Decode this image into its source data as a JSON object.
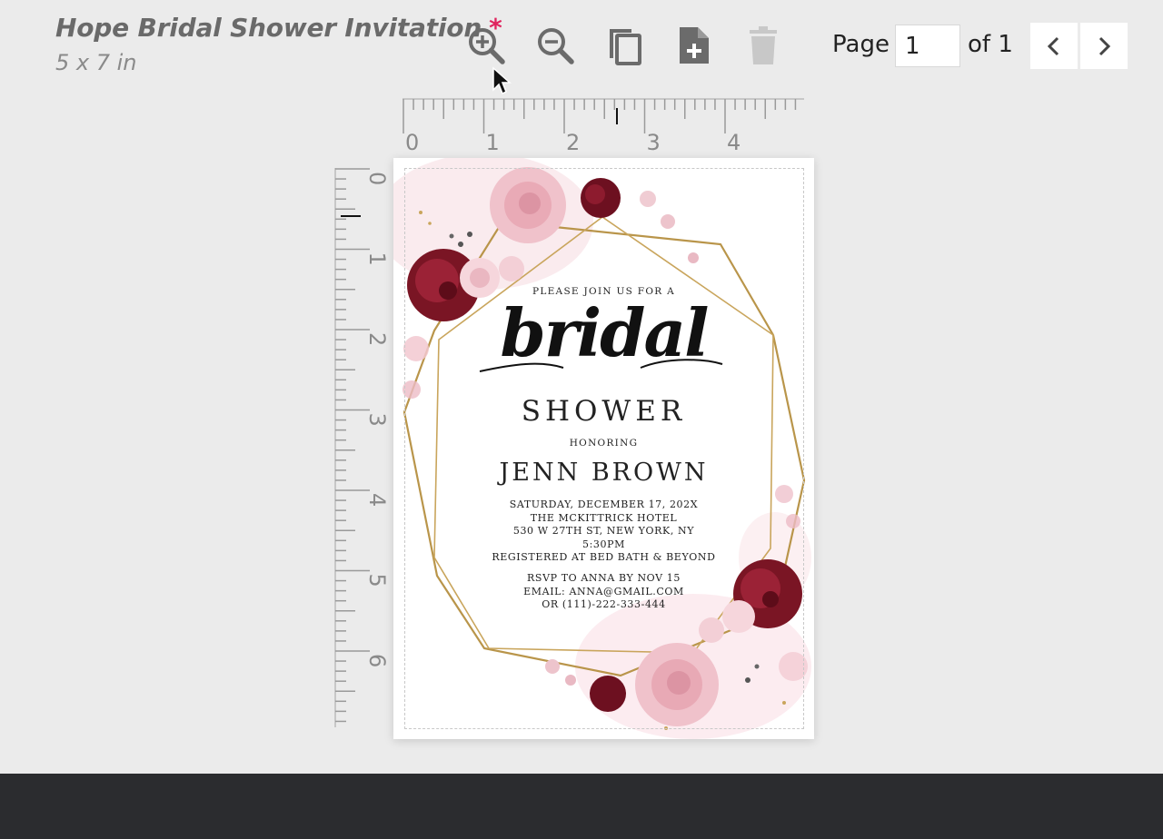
{
  "header": {
    "title": "Hope Bridal Shower Invitation",
    "required_mark": "*",
    "size": "5 x 7 in"
  },
  "toolbar": {
    "icons": [
      "zoom-in-icon",
      "zoom-out-icon",
      "duplicate-icon",
      "add-page-icon",
      "trash-icon"
    ]
  },
  "pager": {
    "label": "Page",
    "current": "1",
    "of_label": "of 1"
  },
  "rulers": {
    "top_labels": [
      "0",
      "1",
      "2",
      "3",
      "4"
    ],
    "left_labels": [
      "0",
      "1",
      "2",
      "3",
      "4",
      "5",
      "6"
    ]
  },
  "invitation": {
    "intro": "PLEASE JOIN US FOR A",
    "script": "bridal",
    "event": "SHOWER",
    "honoring": "HONORING",
    "name": "JENN BROWN",
    "details": [
      "SATURDAY, DECEMBER 17, 202X",
      "THE MCKITTRICK HOTEL",
      "530 W 27TH ST, NEW YORK, NY",
      "5:30PM",
      "REGISTERED AT BED BATH & BEYOND"
    ],
    "rsvp": [
      "RSVP TO ANNA BY NOV 15",
      "EMAIL: ANNA@GMAIL.COM",
      "OR (111)-222-333-444"
    ]
  },
  "colors": {
    "accent_star": "#e0245e",
    "gold_frame": "#b9954a",
    "burgundy": "#7a1524",
    "blush": "#f1c6cf",
    "bottom_bar": "#2b2c2f"
  }
}
